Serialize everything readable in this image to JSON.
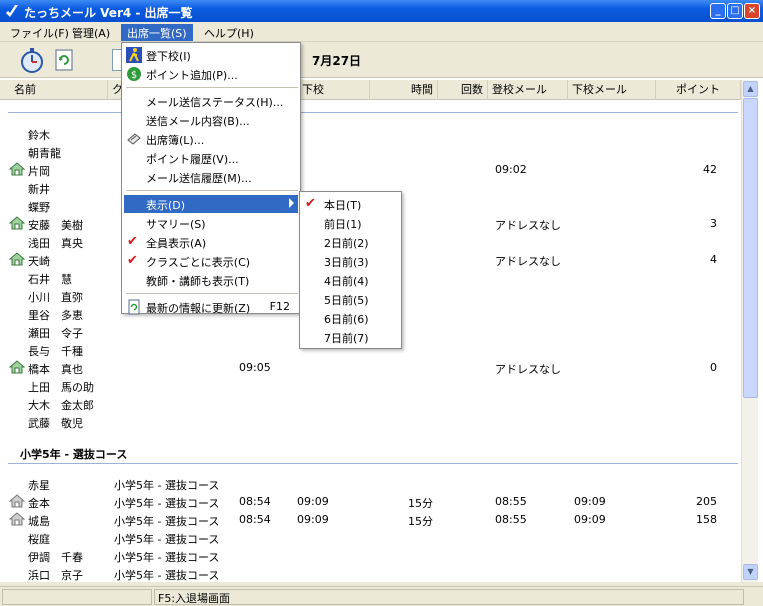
{
  "window": {
    "title": "たっちメール Ver4 - 出席一覧"
  },
  "menubar": [
    "ファイル(F)",
    "管理(A)",
    "出席一覧(S)",
    "ヘルプ(H)"
  ],
  "toolbar": {
    "date": "7月27日"
  },
  "columns": [
    "名前",
    "ク",
    "下校",
    "時間",
    "回数",
    "登校メール",
    "下校メール",
    "ポイント"
  ],
  "rows": [
    {
      "name": "鈴木",
      "icon": false
    },
    {
      "name": "朝青龍",
      "icon": false
    },
    {
      "name": "片岡",
      "icon": true,
      "c1": "09:02",
      "c4": "42"
    },
    {
      "name": "新井",
      "icon": false
    },
    {
      "name": "蝶野",
      "icon": false
    },
    {
      "name": "安藤　美樹",
      "icon": true,
      "c1": "アドレスなし",
      "c4": "3"
    },
    {
      "name": "浅田　真央",
      "icon": false
    },
    {
      "name": "天崎",
      "icon": true,
      "c1": "アドレスなし",
      "c4": "4"
    },
    {
      "name": "石井　慧",
      "icon": false
    },
    {
      "name": "小川　直弥",
      "icon": false
    },
    {
      "name": "里谷　多恵",
      "icon": false
    },
    {
      "name": "瀬田　令子",
      "icon": false
    },
    {
      "name": "長与　千種",
      "icon": false
    },
    {
      "name": "橋本　真也",
      "icon": true,
      "c0": "09:05",
      "c1": "アドレスなし",
      "c4": "0"
    },
    {
      "name": "上田　馬の助",
      "icon": false
    },
    {
      "name": "大木　金太郎",
      "icon": false
    },
    {
      "name": "武藤　敬児",
      "icon": false
    }
  ],
  "group": {
    "title": "小学5年 - 選抜コース"
  },
  "rows2": [
    {
      "name": "赤星",
      "icon": false,
      "cls": "小学5年 - 選抜コース"
    },
    {
      "name": "金本",
      "icon": true,
      "cls": "小学5年 - 選抜コース",
      "t1": "08:54",
      "t2": "09:09",
      "cnt": "15分",
      "m1": "08:55",
      "m2": "09:09",
      "pt": "205"
    },
    {
      "name": "城島",
      "icon": true,
      "cls": "小学5年 - 選抜コース",
      "t1": "08:54",
      "t2": "09:09",
      "cnt": "15分",
      "m1": "08:55",
      "m2": "09:09",
      "pt": "158"
    },
    {
      "name": "桜庭",
      "icon": false,
      "cls": "小学5年 - 選抜コース"
    },
    {
      "name": "伊調　千春",
      "icon": false,
      "cls": "小学5年 - 選抜コース"
    },
    {
      "name": "浜口　京子",
      "icon": false,
      "cls": "小学5年 - 選抜コース"
    }
  ],
  "menu_main": [
    {
      "label": "登下校(I)",
      "icon": "walker"
    },
    {
      "label": "ポイント追加(P)...",
      "icon": "coin"
    },
    {
      "sep": true
    },
    {
      "label": "メール送信ステータス(H)..."
    },
    {
      "label": "送信メール内容(B)..."
    },
    {
      "label": "出席簿(L)...",
      "icon": "book"
    },
    {
      "label": "ポイント履歴(V)..."
    },
    {
      "label": "メール送信履歴(M)..."
    },
    {
      "sep": true
    },
    {
      "label": "表示(D)",
      "sub": true,
      "hl": true
    },
    {
      "label": "サマリー(S)"
    },
    {
      "label": "全員表示(A)",
      "check": true
    },
    {
      "label": "クラスごとに表示(C)",
      "check": true
    },
    {
      "label": "教師・講師も表示(T)"
    },
    {
      "sep": true
    },
    {
      "label": "最新の情報に更新(Z)",
      "icon": "refresh",
      "shortcut": "F12"
    }
  ],
  "menu_sub": [
    {
      "label": "本日(T)",
      "check": true
    },
    {
      "label": "前日(1)"
    },
    {
      "label": "2日前(2)"
    },
    {
      "label": "3日前(3)"
    },
    {
      "label": "4日前(4)"
    },
    {
      "label": "5日前(5)"
    },
    {
      "label": "6日前(6)"
    },
    {
      "label": "7日前(7)"
    }
  ],
  "status": {
    "text": "F5:入退場画面"
  }
}
